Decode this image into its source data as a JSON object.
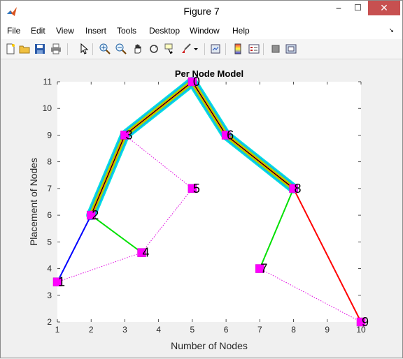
{
  "window": {
    "title": "Figure 7"
  },
  "window_controls": {
    "minimize": "–",
    "maximize": "☐",
    "close": "✕"
  },
  "menu": [
    {
      "label": "File"
    },
    {
      "label": "Edit"
    },
    {
      "label": "View"
    },
    {
      "label": "Insert"
    },
    {
      "label": "Tools"
    },
    {
      "label": "Desktop"
    },
    {
      "label": "Window"
    },
    {
      "label": "Help"
    }
  ],
  "toolbar": {
    "buttons": [
      "new-figure",
      "open-file",
      "save",
      "print",
      "edit-plot",
      "zoom-in",
      "zoom-out",
      "pan",
      "rotate-3d",
      "data-cursor",
      "brush",
      "link-plot",
      "insert-colorbar",
      "insert-legend",
      "hide-plot-tools",
      "show-plot-tools"
    ]
  },
  "chart_data": {
    "type": "line",
    "title": "Per Node Model",
    "xlabel": "Number of Nodes",
    "ylabel": "Placement of Nodes",
    "xlim": [
      1,
      10
    ],
    "ylim": [
      2,
      11
    ],
    "xticks": [
      1,
      2,
      3,
      4,
      5,
      6,
      7,
      8,
      9,
      10
    ],
    "yticks": [
      2,
      3,
      4,
      5,
      6,
      7,
      8,
      9,
      10,
      11
    ],
    "nodes": [
      {
        "id": "0",
        "x": 5,
        "y": 11
      },
      {
        "id": "1",
        "x": 1,
        "y": 3.5
      },
      {
        "id": "2",
        "x": 2,
        "y": 6
      },
      {
        "id": "3",
        "x": 3,
        "y": 9
      },
      {
        "id": "4",
        "x": 3.5,
        "y": 4.6
      },
      {
        "id": "5",
        "x": 5,
        "y": 7
      },
      {
        "id": "6",
        "x": 6,
        "y": 9
      },
      {
        "id": "7",
        "x": 7,
        "y": 4
      },
      {
        "id": "8",
        "x": 8,
        "y": 7
      },
      {
        "id": "9",
        "x": 10,
        "y": 2
      }
    ],
    "dotted_edges": [
      [
        "1",
        "4"
      ],
      [
        "4",
        "5"
      ],
      [
        "5",
        "3"
      ],
      [
        "7",
        "9"
      ]
    ],
    "thick_path": [
      "2",
      "3",
      "0",
      "6",
      "8"
    ],
    "edges": [
      {
        "from": "1",
        "to": "2",
        "color": "#0000ff"
      },
      {
        "from": "2",
        "to": "4",
        "color": "#00e000"
      },
      {
        "from": "7",
        "to": "8",
        "color": "#00e000"
      },
      {
        "from": "8",
        "to": "9",
        "color": "#ff0000"
      }
    ],
    "colors": {
      "marker": "#ff00ff",
      "dotted": "#e000e0",
      "thick_layers": [
        "#00e0e0",
        "#1aa0ff",
        "#80ff00",
        "#ff8000",
        "#000000"
      ]
    }
  }
}
